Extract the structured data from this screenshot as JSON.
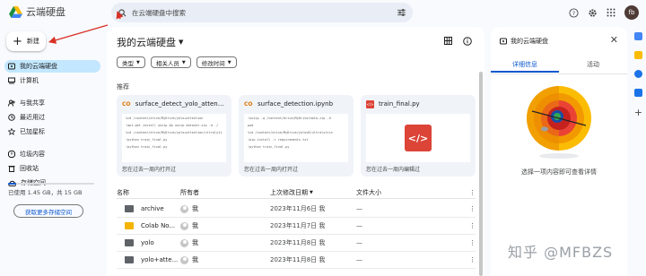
{
  "app": {
    "name": "云端硬盘"
  },
  "search": {
    "placeholder": "在云端硬盘中搜索"
  },
  "account": {
    "initials": "fb"
  },
  "sidebar": {
    "new_label": "新建",
    "items": [
      {
        "label": "我的云端硬盘",
        "icon": "my-drive-icon",
        "active": true
      },
      {
        "label": "计算机",
        "icon": "computer-icon"
      },
      {
        "label": "与我共享",
        "icon": "shared-icon"
      },
      {
        "label": "最近用过",
        "icon": "recent-icon"
      },
      {
        "label": "已加星标",
        "icon": "star-icon"
      },
      {
        "label": "垃圾内容",
        "icon": "spam-icon"
      },
      {
        "label": "回收站",
        "icon": "trash-icon"
      },
      {
        "label": "存储空间",
        "icon": "cloud-icon"
      }
    ],
    "storage": {
      "text": "已使用 1.45 GB，共 15 GB",
      "used_fraction": 0.097
    },
    "more_storage_label": "获取更多存储空间"
  },
  "main": {
    "title": "我的云端硬盘",
    "filters": [
      "类型",
      "相关人员",
      "修改时间"
    ],
    "suggested_label": "推荐",
    "cards": [
      {
        "name": "surface_detect_yolo_attenti...",
        "type": "ipynb",
        "footer": "您在过去一周内打开过",
        "preview": [
          "%cd /content/drive/MyDrive/yolo+attention",
          "!apt-get install unzip && unzip dataset.zip -d ./",
          "%cd /content/drive/MyDrive/yolo+attention/ultralytics",
          "!python train_final.py",
          "!python train_final.py"
        ]
      },
      {
        "name": "surface_detection.ipynb",
        "type": "ipynb",
        "footer": "您在过去一周内打开过",
        "preview": [
          "!unzip -q /content/drive/MyDrive/data.zip -d",
          "pwd",
          "%cd /content/drive/MyDrive/yolov8/ultralytics",
          "!pip install -r requirements.txt",
          "!python train_final.py"
        ]
      },
      {
        "name": "train_final.py",
        "type": "py",
        "footer": "您在过去一周内编辑过",
        "preview": []
      }
    ],
    "columns": {
      "name": "名称",
      "owner": "所有者",
      "modified": "上次修改日期",
      "size": "文件大小"
    },
    "rows": [
      {
        "name": "archive",
        "owner": "我",
        "modified": "2023年11月6日 我",
        "size": "—",
        "folder_color": "#5f6368"
      },
      {
        "name": "Colab No...",
        "owner": "我",
        "modified": "2023年11月7日 我",
        "size": "—",
        "folder_color": "#f4b400"
      },
      {
        "name": "yolo",
        "owner": "我",
        "modified": "2023年11月8日 我",
        "size": "—",
        "folder_color": "#5f6368"
      },
      {
        "name": "yolo+atte...",
        "owner": "我",
        "modified": "2023年11月8日 我",
        "size": "—",
        "folder_color": "#5f6368"
      }
    ]
  },
  "detail": {
    "title": "我的云端硬盘",
    "tabs": [
      "详细信息",
      "活动"
    ],
    "active_tab": 0,
    "hint": "选择一项内容即可查看详情"
  },
  "watermark": "知乎 @MFBZS",
  "colors": {
    "accent": "#0b57d0",
    "active_nav": "#c2e7ff",
    "arrow": "#d93025"
  }
}
